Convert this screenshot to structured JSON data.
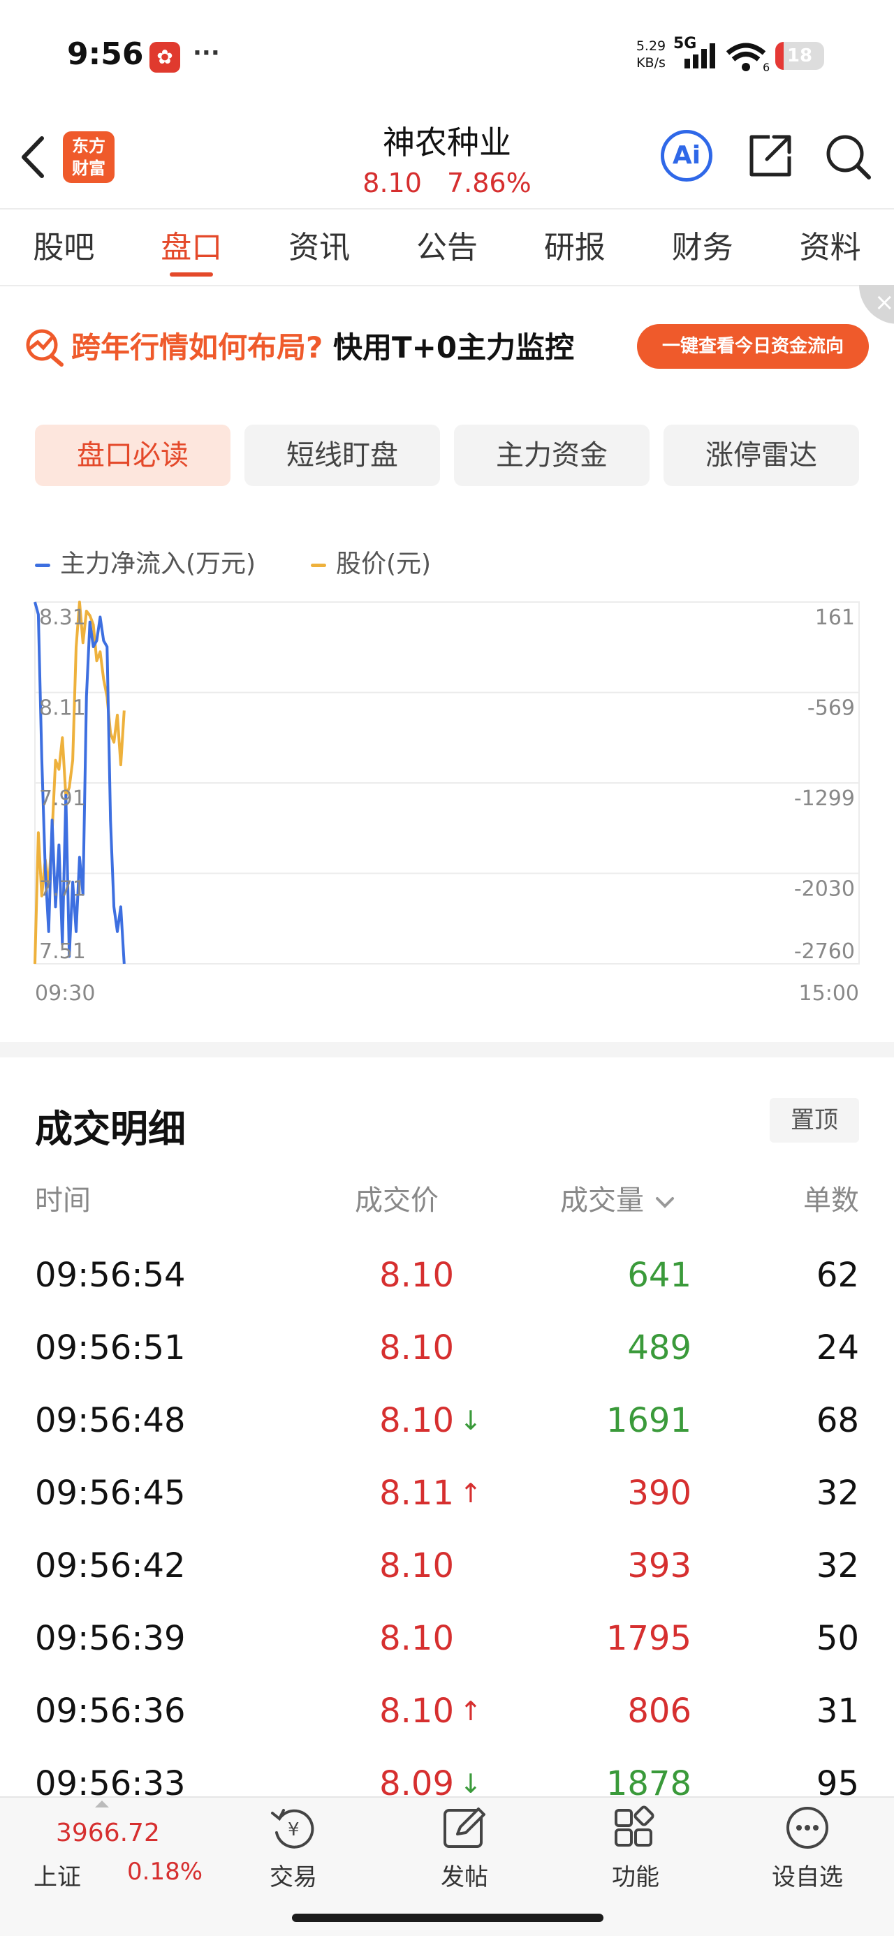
{
  "status_bar": {
    "time": "9:56",
    "more": "···",
    "net_rate_value": "5.29",
    "net_rate_unit": "KB/s",
    "network": "5G",
    "wifi_level": "6",
    "battery": "18"
  },
  "header": {
    "brand_line1": "东方",
    "brand_line2": "财富",
    "stock_name": "神农种业",
    "price": "8.10",
    "change_pct": "7.86%",
    "ai_label": "Ai"
  },
  "tabs": [
    "股吧",
    "盘口",
    "资讯",
    "公告",
    "研报",
    "财务",
    "资料"
  ],
  "active_tab_index": 1,
  "banner": {
    "text_highlight": "跨年行情如何布局?",
    "text_main": "快用T+0主力监控",
    "button_label": "一键查看今日资金流向",
    "close": "×"
  },
  "subtabs": [
    "盘口必读",
    "短线盯盘",
    "主力资金",
    "涨停雷达"
  ],
  "active_subtab_index": 0,
  "colors": {
    "up_red": "#d62f2f",
    "down_green": "#3a9a3a",
    "accent_orange": "#e4492a",
    "flow_blue": "#3d6fe0",
    "price_orange": "#eeb13c"
  },
  "chart_data": {
    "type": "line",
    "legend": [
      {
        "name": "主力净流入(万元)",
        "color": "#3d6fe0"
      },
      {
        "name": "股价(元)",
        "color": "#eeb13c"
      }
    ],
    "left_axis_ticks": [
      "8.31",
      "8.11",
      "7.91",
      "7.71",
      "7.51"
    ],
    "right_axis_ticks": [
      "161",
      "-569",
      "-1299",
      "-2030",
      "-2760"
    ],
    "x_ticks": [
      "09:30",
      "15:00"
    ],
    "price_ylim": [
      7.51,
      8.31
    ],
    "flow_ylim": [
      -2760,
      161
    ],
    "series": [
      {
        "name": "主力净流入(万元)",
        "axis": "right",
        "x_minutes_from_open": [
          0,
          1,
          2,
          3,
          4,
          5,
          6,
          7,
          8,
          9,
          10,
          11,
          12,
          13,
          14,
          15,
          16,
          17,
          18,
          19,
          20,
          21,
          22,
          23,
          24,
          25,
          26
        ],
        "values": [
          200,
          60,
          -1100,
          -2000,
          -2500,
          -1600,
          -2300,
          -1800,
          -2600,
          -1400,
          -2700,
          -2100,
          -2500,
          -1900,
          -2200,
          -600,
          0,
          -200,
          -150,
          40,
          -150,
          -200,
          -1600,
          -2300,
          -2500,
          -2300,
          -2800
        ]
      },
      {
        "name": "股价(元)",
        "axis": "left",
        "x_minutes_from_open": [
          0,
          1,
          2,
          3,
          4,
          5,
          6,
          7,
          8,
          9,
          10,
          11,
          12,
          13,
          14,
          15,
          16,
          17,
          18,
          19,
          20,
          21,
          22,
          23,
          24,
          25,
          26
        ],
        "values": [
          7.5,
          7.8,
          7.66,
          7.74,
          7.68,
          7.8,
          7.96,
          7.94,
          8.01,
          7.88,
          7.9,
          7.96,
          8.21,
          8.34,
          8.22,
          8.29,
          8.28,
          8.26,
          8.18,
          8.2,
          8.14,
          8.1,
          8.02,
          8.0,
          8.06,
          7.95,
          8.07
        ]
      }
    ]
  },
  "trade_detail": {
    "title": "成交明细",
    "pin_label": "置顶",
    "headers": {
      "time": "时间",
      "price": "成交价",
      "volume": "成交量",
      "count": "单数"
    },
    "rows": [
      {
        "time": "09:56:54",
        "price": "8.10",
        "arrow": "",
        "volume": "641",
        "vol_dir": "down",
        "count": "62"
      },
      {
        "time": "09:56:51",
        "price": "8.10",
        "arrow": "",
        "volume": "489",
        "vol_dir": "down",
        "count": "24"
      },
      {
        "time": "09:56:48",
        "price": "8.10",
        "arrow": "↓",
        "volume": "1691",
        "vol_dir": "down",
        "count": "68"
      },
      {
        "time": "09:56:45",
        "price": "8.11",
        "arrow": "↑",
        "volume": "390",
        "vol_dir": "up",
        "count": "32"
      },
      {
        "time": "09:56:42",
        "price": "8.10",
        "arrow": "",
        "volume": "393",
        "vol_dir": "up",
        "count": "32"
      },
      {
        "time": "09:56:39",
        "price": "8.10",
        "arrow": "",
        "volume": "1795",
        "vol_dir": "up",
        "count": "50"
      },
      {
        "time": "09:56:36",
        "price": "8.10",
        "arrow": "↑",
        "volume": "806",
        "vol_dir": "up",
        "count": "31"
      },
      {
        "time": "09:56:33",
        "price": "8.09",
        "arrow": "↓",
        "volume": "1878",
        "vol_dir": "down",
        "count": "95"
      }
    ]
  },
  "bottom_bar": {
    "index_value": "3966.72",
    "index_name": "上证",
    "index_change": "0.18%",
    "nav": [
      {
        "label": "交易",
        "icon": "yen-trade-icon"
      },
      {
        "label": "发帖",
        "icon": "compose-icon"
      },
      {
        "label": "功能",
        "icon": "grid-icon"
      },
      {
        "label": "设自选",
        "icon": "more-circle-icon"
      }
    ]
  }
}
